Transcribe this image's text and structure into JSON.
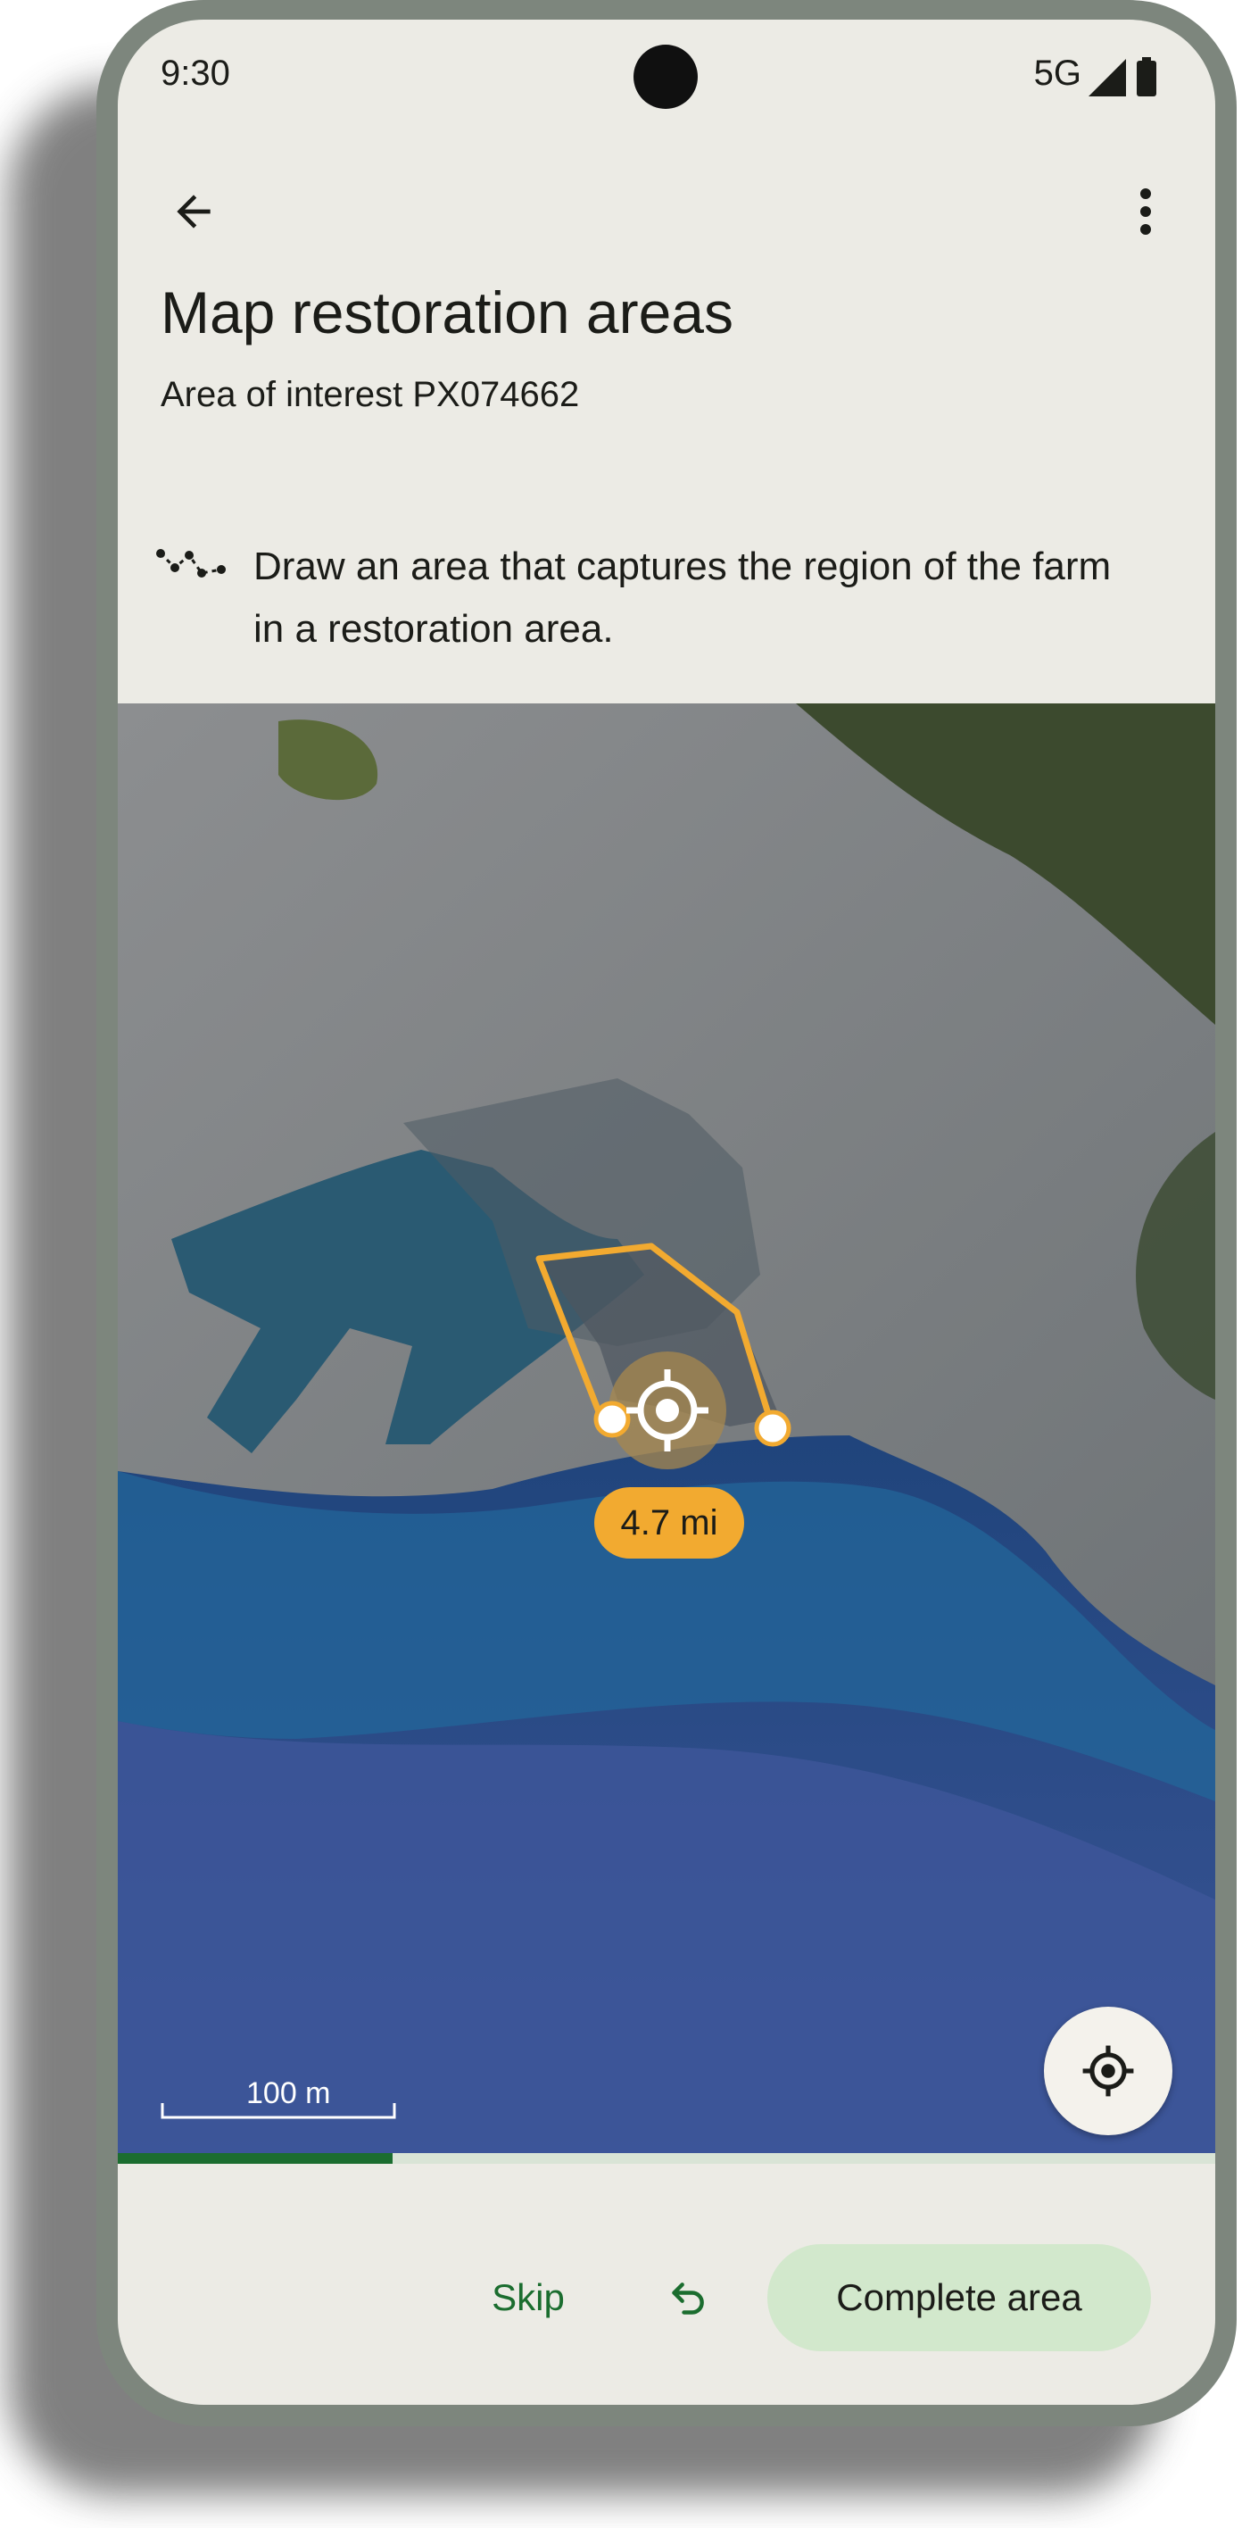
{
  "status_bar": {
    "time": "9:30",
    "network": "5G"
  },
  "header": {
    "title": "Map restoration areas",
    "subtitle": "Area of interest PX074662"
  },
  "instruction": {
    "text": "Draw an area that captures the region of the farm in a restoration area."
  },
  "map": {
    "measurement": "4.7 mi",
    "scale_label": "100 m",
    "polygon_color": "#F2AA30"
  },
  "progress": {
    "fraction": 0.25
  },
  "actions": {
    "skip_label": "Skip",
    "complete_label": "Complete area"
  },
  "colors": {
    "accent": "#1B6D2F",
    "tonal_button": "#D2E8CC",
    "highlight": "#F2AA30"
  }
}
